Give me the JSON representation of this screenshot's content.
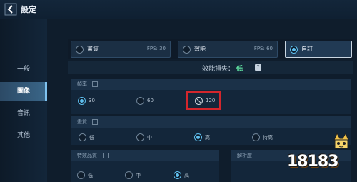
{
  "header": {
    "title": "設定"
  },
  "sidebar": {
    "items": [
      {
        "label": "一般"
      },
      {
        "label": "圖像",
        "active": true
      },
      {
        "label": "音訊"
      },
      {
        "label": "其他"
      }
    ]
  },
  "modes": [
    {
      "label": "畫質",
      "fps": "FPS: 30"
    },
    {
      "label": "效能",
      "fps": "FPS: 60"
    },
    {
      "label": "自訂",
      "selected": true
    }
  ],
  "performance_loss": {
    "label": "效能損失：",
    "value": "低"
  },
  "frame_rate": {
    "title": "幀率",
    "options": [
      {
        "label": "30",
        "selected": true
      },
      {
        "label": "60"
      },
      {
        "label": "120",
        "disabled": true
      }
    ]
  },
  "quality": {
    "title": "畫質",
    "options": [
      {
        "label": "低"
      },
      {
        "label": "中"
      },
      {
        "label": "高",
        "selected": true
      },
      {
        "label": "特高"
      }
    ]
  },
  "effects": {
    "title": "特效品質",
    "options": [
      {
        "label": "低"
      },
      {
        "label": "中"
      },
      {
        "label": "高",
        "selected": true
      }
    ]
  },
  "resolution": {
    "title": "解析度"
  },
  "watermark": {
    "text": "18183"
  },
  "colors": {
    "accent": "#5fc0f0",
    "highlight": "#d3262c",
    "loss_value": "#5fe0a0"
  }
}
